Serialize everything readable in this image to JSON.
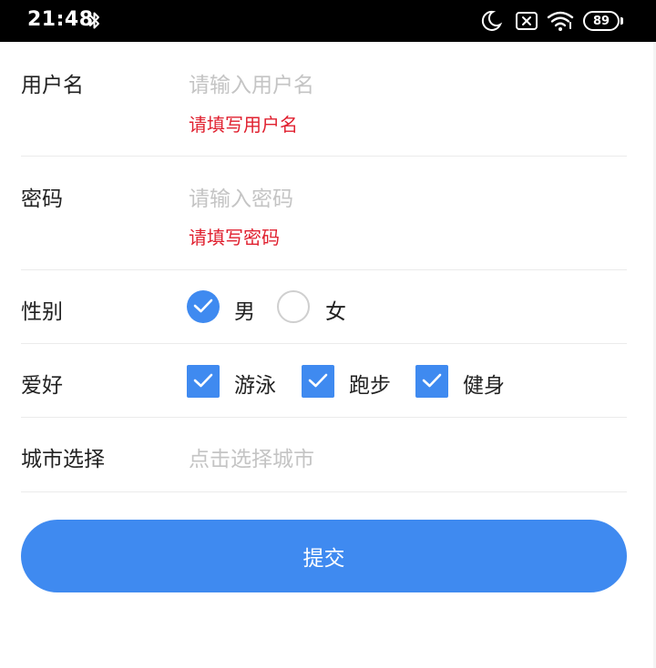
{
  "status_bar": {
    "time": "21:48",
    "battery_level": "89",
    "icons": [
      "bluetooth-icon",
      "moon-icon",
      "no-sim-icon",
      "wifi-icon",
      "battery-icon"
    ]
  },
  "form": {
    "username": {
      "label": "用户名",
      "placeholder": "请输入用户名",
      "error": "请填写用户名"
    },
    "password": {
      "label": "密码",
      "placeholder": "请输入密码",
      "error": "请填写密码"
    },
    "gender": {
      "label": "性别",
      "options": [
        {
          "label": "男",
          "checked": true
        },
        {
          "label": "女",
          "checked": false
        }
      ]
    },
    "hobbies": {
      "label": "爱好",
      "options": [
        {
          "label": "游泳",
          "checked": true
        },
        {
          "label": "跑步",
          "checked": true
        },
        {
          "label": "健身",
          "checked": true
        }
      ]
    },
    "city": {
      "label": "城市选择",
      "placeholder": "点击选择城市"
    },
    "submit_label": "提交"
  },
  "colors": {
    "accent": "#3f8af0",
    "error": "#e0202f",
    "placeholder": "#c4c4c4",
    "text": "#222222"
  }
}
